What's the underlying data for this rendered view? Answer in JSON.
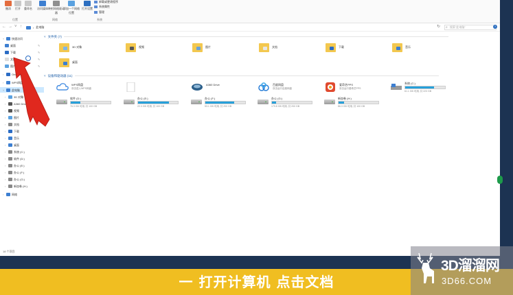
{
  "ribbon": {
    "buttons": [
      {
        "label": "撤消",
        "icon": "undo-icon"
      },
      {
        "label": "打开",
        "icon": "open-icon"
      },
      {
        "label": "重命名",
        "icon": "rename-icon"
      },
      {
        "label": "访问媒体",
        "icon": "media-icon"
      },
      {
        "label": "映射网络驱动器",
        "icon": "map-drive-icon"
      },
      {
        "label": "添加一个网络位置",
        "icon": "network-location-icon"
      },
      {
        "label": "打开设置",
        "icon": "settings-icon"
      }
    ],
    "small_items": [
      "卸载或更改程序",
      "系统属性",
      "管理"
    ],
    "groups": [
      "位置",
      "网络",
      "系统"
    ]
  },
  "address": {
    "path": [
      "此电脑"
    ],
    "search_placeholder": "搜索\"此电脑\""
  },
  "sidebar": {
    "items": [
      {
        "label": "快速访问",
        "icon": "star-icon",
        "color": "#3d7fd1"
      },
      {
        "label": "桌面",
        "icon": "desktop-icon",
        "color": "#3d7fd1",
        "pinned": true
      },
      {
        "label": "下载",
        "icon": "download-icon",
        "color": "#2b6cc4",
        "pinned": true
      },
      {
        "label": "文档",
        "icon": "document-icon",
        "color": "#dcdcdc",
        "pinned": true
      },
      {
        "label": "图片",
        "icon": "picture-icon",
        "color": "#5aa1e0",
        "pinned": true
      },
      {
        "label": "OneDrive",
        "icon": "cloud-icon",
        "color": "#2b6cc4"
      },
      {
        "label": "WPS网盘",
        "icon": "wps-cloud-icon",
        "color": "#3d7fd1"
      },
      {
        "label": "此电脑",
        "icon": "pc-icon",
        "color": "#3d7fd1"
      },
      {
        "label": "3D 对象",
        "icon": "3d-icon",
        "color": "#5aa1e0"
      },
      {
        "label": "A360 Drive",
        "icon": "a360-icon",
        "color": "#555555"
      },
      {
        "label": "视频",
        "icon": "video-icon",
        "color": "#555555"
      },
      {
        "label": "图片",
        "icon": "picture-icon",
        "color": "#5aa1e0"
      },
      {
        "label": "文档",
        "icon": "document-icon",
        "color": "#888888"
      },
      {
        "label": "下载",
        "icon": "download-icon",
        "color": "#2b6cc4"
      },
      {
        "label": "音乐",
        "icon": "music-icon",
        "color": "#3d7fd1"
      },
      {
        "label": "桌面",
        "icon": "desktop-icon",
        "color": "#3d7fd1"
      },
      {
        "label": "系统 (C:)",
        "icon": "drive-icon",
        "color": "#888888"
      },
      {
        "label": "软件 (D:)",
        "icon": "drive-icon",
        "color": "#888888"
      },
      {
        "label": "办公 (E:)",
        "icon": "drive-icon",
        "color": "#888888"
      },
      {
        "label": "办公 (F:)",
        "icon": "drive-icon",
        "color": "#888888"
      },
      {
        "label": "办公 (G:)",
        "icon": "drive-icon",
        "color": "#888888"
      },
      {
        "label": "新加卷 (H:)",
        "icon": "drive-icon",
        "color": "#888888"
      },
      {
        "label": "网络",
        "icon": "network-icon",
        "color": "#3d7fd1"
      }
    ]
  },
  "folders": {
    "header": "文件夹 (7)",
    "items": [
      {
        "label": "3D 对象",
        "icon": "3d-folder-icon",
        "badge": "#7fb6e8"
      },
      {
        "label": "视频",
        "icon": "video-folder-icon",
        "badge": "#555555"
      },
      {
        "label": "图片",
        "icon": "picture-folder-icon",
        "badge": "#6aa2d8"
      },
      {
        "label": "文档",
        "icon": "document-folder-icon",
        "badge": "#e6e6e6"
      },
      {
        "label": "下载",
        "icon": "download-folder-icon",
        "badge": "#2b6cc4"
      },
      {
        "label": "音乐",
        "icon": "music-folder-icon",
        "badge": "#3d7fd1"
      },
      {
        "label": "桌面",
        "icon": "desktop-folder-icon",
        "badge": "#3d7fd1"
      }
    ]
  },
  "devices": {
    "header": "设备和驱动器 (11)",
    "apps": [
      {
        "name": "WPS网盘",
        "desc": "双击进入WPS网盘",
        "icon": "wps-cloud-icon",
        "color": "#4a90e2"
      },
      {
        "name": "",
        "desc": "",
        "icon": "blank-page-icon",
        "color": "#e0e0e0"
      },
      {
        "name": "A360 Drive",
        "desc": "",
        "icon": "a360-icon",
        "color": "#2c5f8a"
      },
      {
        "name": "百度网盘",
        "desc": "双击运行百度网盘",
        "icon": "baidu-cloud-icon",
        "color": "#2b7fd8"
      },
      {
        "name": "爱奇艺PPS",
        "desc": "双击运行爱奇艺PPS",
        "icon": "iqiyi-icon",
        "color": "#e04a2f"
      },
      {
        "name": "系统 (C:)",
        "desc": "",
        "icon": "windows-drive-icon",
        "color": "#3d7fd1"
      }
    ],
    "c_drive": {
      "free": "61.1 GB 可用, 共 223 GB",
      "used": 0.73
    },
    "drives": [
      {
        "name": "软件 (D:)",
        "free": "76.3 GB 可用, 共 100 GB",
        "used": 0.24
      },
      {
        "name": "办公 (E:)",
        "free": "22.3 GB 可用, 共 100 GB",
        "used": 0.78
      },
      {
        "name": "办公 (F:)",
        "free": "53.1 GB 可用, 共 200 GB",
        "used": 0.73
      },
      {
        "name": "办公 (G:)",
        "free": "179.8 GB 可用, 共 200 GB",
        "used": 0.1
      },
      {
        "name": "新加卷 (H:)",
        "free": "86.3 GB 可用, 共 100 GB",
        "used": 0.14
      }
    ]
  },
  "status": "18 个项目",
  "caption": "一 打开计算机 点击文档",
  "watermark": {
    "line1": "3D溜溜网",
    "line2": "3D66.COM"
  }
}
